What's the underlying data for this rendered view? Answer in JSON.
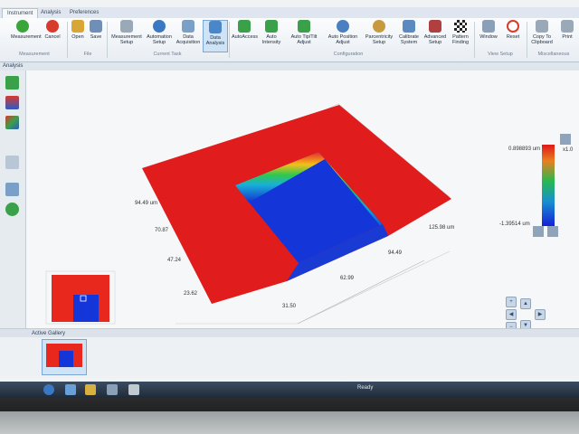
{
  "tabs": [
    "Instrument",
    "Analysis",
    "Preferences"
  ],
  "ribbon": {
    "buttons": [
      {
        "label": "Measurement",
        "icon": "play-icon",
        "color": "#3aa63a"
      },
      {
        "label": "Cancel",
        "icon": "cancel-icon",
        "color": "#d83a2c"
      },
      {
        "label": "Open",
        "icon": "open-folder-icon",
        "color": "#d8a634"
      },
      {
        "label": "Save",
        "icon": "save-icon",
        "color": "#6f8fb8"
      },
      {
        "label": "Measurement Setup",
        "icon": "measurement-setup-icon",
        "color": "#9aa9b8"
      },
      {
        "label": "Automation Setup",
        "icon": "automation-setup-icon",
        "color": "#3a78c4"
      },
      {
        "label": "Data Acquisition",
        "icon": "data-acquisition-icon",
        "color": "#7aa0c8"
      },
      {
        "label": "Data Analysis",
        "icon": "data-analysis-icon",
        "color": "#4a86c8"
      },
      {
        "label": "AutoAccess",
        "icon": "auto-access-icon",
        "color": "#3aa04a"
      },
      {
        "label": "Auto Intensity",
        "icon": "auto-intensity-icon",
        "color": "#3aa04a"
      },
      {
        "label": "Auto Tip/Tilt Adjust",
        "icon": "auto-tip-tilt-icon",
        "color": "#3aa04a"
      },
      {
        "label": "Auto Position Adjust",
        "icon": "auto-position-icon",
        "color": "#4a80c0"
      },
      {
        "label": "Parcentricity Setup",
        "icon": "parcentricity-icon",
        "color": "#c89a40"
      },
      {
        "label": "Calibrate System",
        "icon": "calibrate-icon",
        "color": "#5a8ac0"
      },
      {
        "label": "Advanced Setup",
        "icon": "advanced-setup-icon",
        "color": "#b04040"
      },
      {
        "label": "Pattern Finding",
        "icon": "pattern-finding-icon",
        "color": "#222222"
      },
      {
        "label": "Window",
        "icon": "window-icon",
        "color": "#8aa0b8"
      },
      {
        "label": "Reset",
        "icon": "reset-icon",
        "color": "#d83a2c"
      },
      {
        "label": "Copy To Clipboard",
        "icon": "clipboard-icon",
        "color": "#9aa9b8"
      },
      {
        "label": "Print",
        "icon": "print-icon",
        "color": "#9aa9b8"
      }
    ],
    "groups": [
      "Measurement",
      "File",
      "Current Task",
      "Configuration",
      "View Setup",
      "Miscellaneous"
    ]
  },
  "panel_title": "Analysis",
  "plot": {
    "legend_max": "0.898893 um",
    "legend_min": "-1.39514 um",
    "legend_scale": "x1.0",
    "axis_y_max": "94.49 um",
    "axis_x_max": "125.98 um",
    "ticks_left": [
      "70.87",
      "47.24",
      "23.62"
    ],
    "ticks_bottom": [
      "31.50",
      "62.99",
      "94.49"
    ]
  },
  "gallery_title": "Active Gallery",
  "status_text": "Ready",
  "colors": {
    "surface_high": "#e01818",
    "surface_low": "#1436d8",
    "accent": "#4a86c8"
  }
}
